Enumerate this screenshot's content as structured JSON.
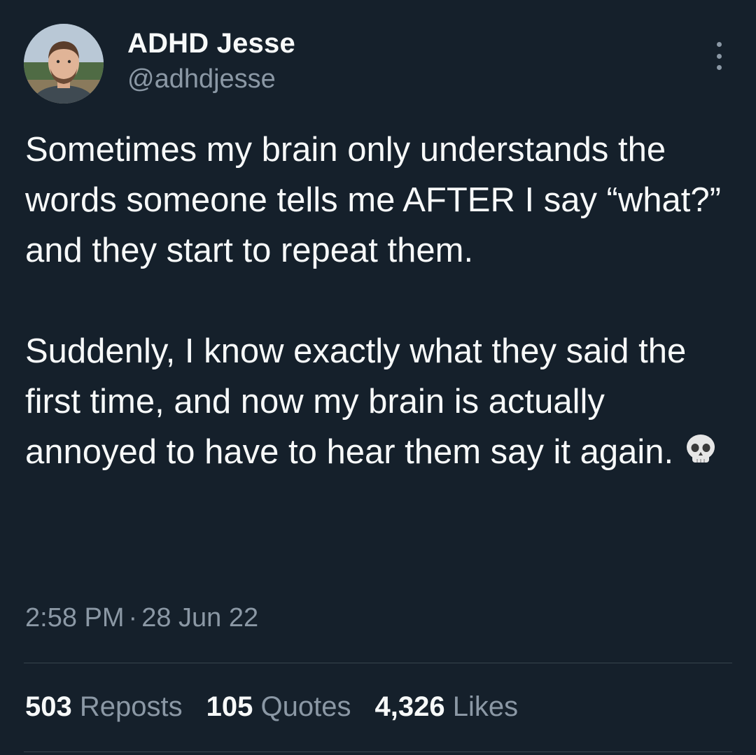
{
  "author": {
    "name": "ADHD Jesse",
    "handle": "@adhdjesse",
    "avatar_icon": "profile-photo"
  },
  "menu": {
    "icon": "more-vertical-icon"
  },
  "tweet": {
    "paragraph1": "Sometimes my brain only understands the words someone tells me AFTER I say “what?” and they start to repeat them.",
    "paragraph2": "Suddenly, I know exactly what they said the first time, and now my brain is actually annoyed to have to hear them say it again.",
    "emoji": "skull-emoji"
  },
  "meta": {
    "time": "2:58 PM",
    "separator": "·",
    "date": "28 Jun 22"
  },
  "stats": {
    "reposts_count": "503",
    "reposts_label": "Reposts",
    "quotes_count": "105",
    "quotes_label": "Quotes",
    "likes_count": "4,326",
    "likes_label": "Likes"
  },
  "colors": {
    "background": "#15202b",
    "text_primary": "#f7f9f9",
    "text_secondary": "#8b98a5",
    "divider": "#38444d"
  }
}
